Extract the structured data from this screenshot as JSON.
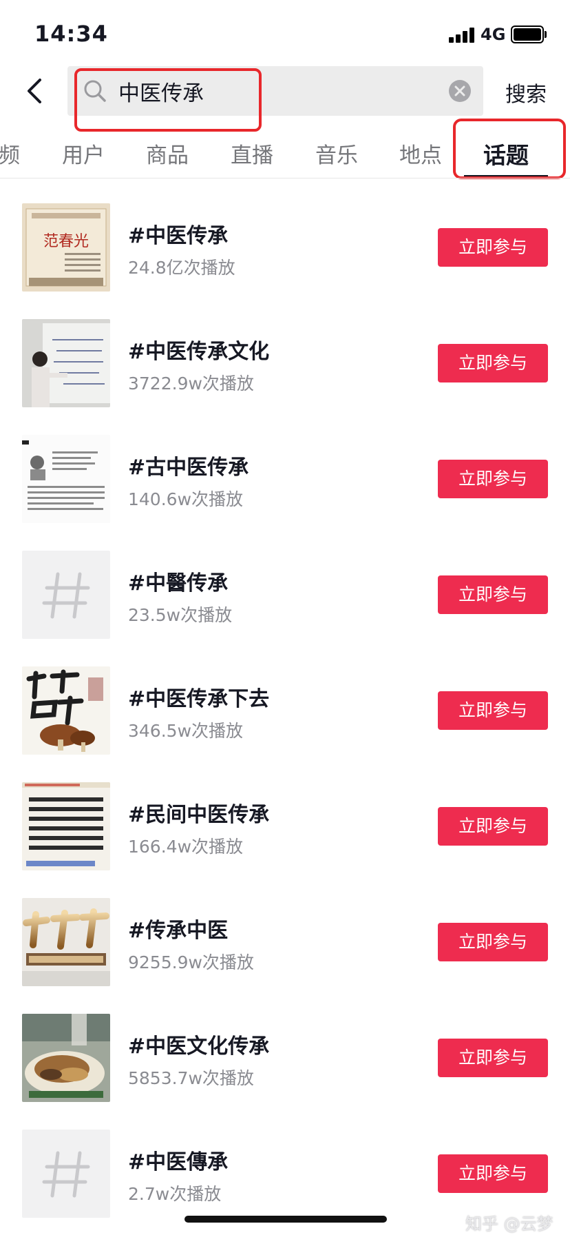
{
  "status_bar": {
    "time": "14:34",
    "network": "4G"
  },
  "search": {
    "query": "中医传承",
    "button_label": "搜索"
  },
  "tabs": [
    {
      "label": "频",
      "active": false
    },
    {
      "label": "用户",
      "active": false
    },
    {
      "label": "商品",
      "active": false
    },
    {
      "label": "直播",
      "active": false
    },
    {
      "label": "音乐",
      "active": false
    },
    {
      "label": "地点",
      "active": false
    },
    {
      "label": "话题",
      "active": true
    }
  ],
  "colors": {
    "accent_button": "#ee2c4f",
    "highlight_box": "#e8272b",
    "text_primary": "#161823",
    "text_secondary": "#8a8b91"
  },
  "topics": [
    {
      "title": "#中医传承",
      "count": "24.8亿次播放",
      "join_label": "立即参与",
      "thumb": "book-cover"
    },
    {
      "title": "#中医传承文化",
      "count": "3722.9w次播放",
      "join_label": "立即参与",
      "thumb": "whiteboard-lecture"
    },
    {
      "title": "#古中医传承",
      "count": "140.6w次播放",
      "join_label": "立即参与",
      "thumb": "profile-document"
    },
    {
      "title": "#中醫传承",
      "count": "23.5w次播放",
      "join_label": "立即参与",
      "thumb": "hashtag-placeholder"
    },
    {
      "title": "#中医传承下去",
      "count": "346.5w次播放",
      "join_label": "立即参与",
      "thumb": "calligraphy-mushroom"
    },
    {
      "title": "#民间中医传承",
      "count": "166.4w次播放",
      "join_label": "立即参与",
      "thumb": "text-notice"
    },
    {
      "title": "#传承中医",
      "count": "9255.9w次播放",
      "join_label": "立即参与",
      "thumb": "golden-calligraphy"
    },
    {
      "title": "#中医文化传承",
      "count": "5853.7w次播放",
      "join_label": "立即参与",
      "thumb": "herbs-plate"
    },
    {
      "title": "#中医傳承",
      "count": "2.7w次播放",
      "join_label": "立即参与",
      "thumb": "hashtag-placeholder"
    }
  ],
  "watermark": "知乎 @云梦"
}
